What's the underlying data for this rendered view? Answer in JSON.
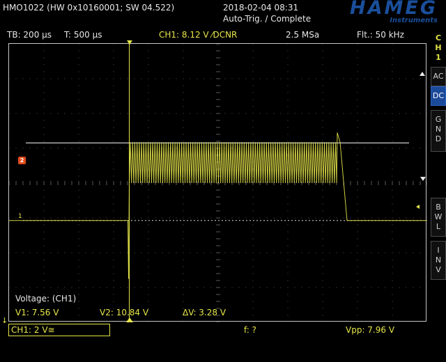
{
  "header": {
    "model": "HMO1022 (HW 0x10160001; SW 04.522)",
    "datetime": "2018-02-04 08:31",
    "trigger_state": "Auto-Trig. / Complete",
    "brand": "HAMEG",
    "brand_sub": "Instruments"
  },
  "status": {
    "timebase": "TB: 200 µs",
    "trigger_time": "T: 500 µs",
    "channel_info": "CH1: 8.12 V ⁄DCNR",
    "sample_rate": "2.5 MSa",
    "filter": "Flt.: 50 kHz"
  },
  "side_menu": {
    "channel": "C\nH\n1",
    "ac": "AC",
    "dc": "DC",
    "gnd": "G\nN\nD",
    "bwl": "B\nW\nL",
    "inv": "I\nN\nV"
  },
  "cursor_panel": {
    "title": "Voltage: (CH1)",
    "v1": "V1: 7.56 V",
    "v2": "V2: 10.84 V",
    "dv": "ΔV: 3.28 V"
  },
  "bottom": {
    "ch1_setting": "CH1: 2 V≅",
    "frequency": "f: ?",
    "vpp": "Vpp: 7.96 V"
  },
  "markers": {
    "trigger_flag": "2",
    "ch1_marker": "1",
    "ground_marker": "↓"
  },
  "colors": {
    "trace": "#e6e64a",
    "grid": "#5a5a5a",
    "cursor_line": "#ffffff",
    "accent_blue": "#1c4a9a",
    "trigger_flag": "#e24a1a"
  },
  "waveform": {
    "unit": "V",
    "volts_per_div": 2,
    "description_levels": {
      "baseline": -2.15,
      "burst_low": 0.0,
      "burst_high": 2.35,
      "spike_low": -5.5,
      "overshoot": 2.9
    },
    "burst_start_div": 3.45,
    "burst_end_div": 9.5
  }
}
